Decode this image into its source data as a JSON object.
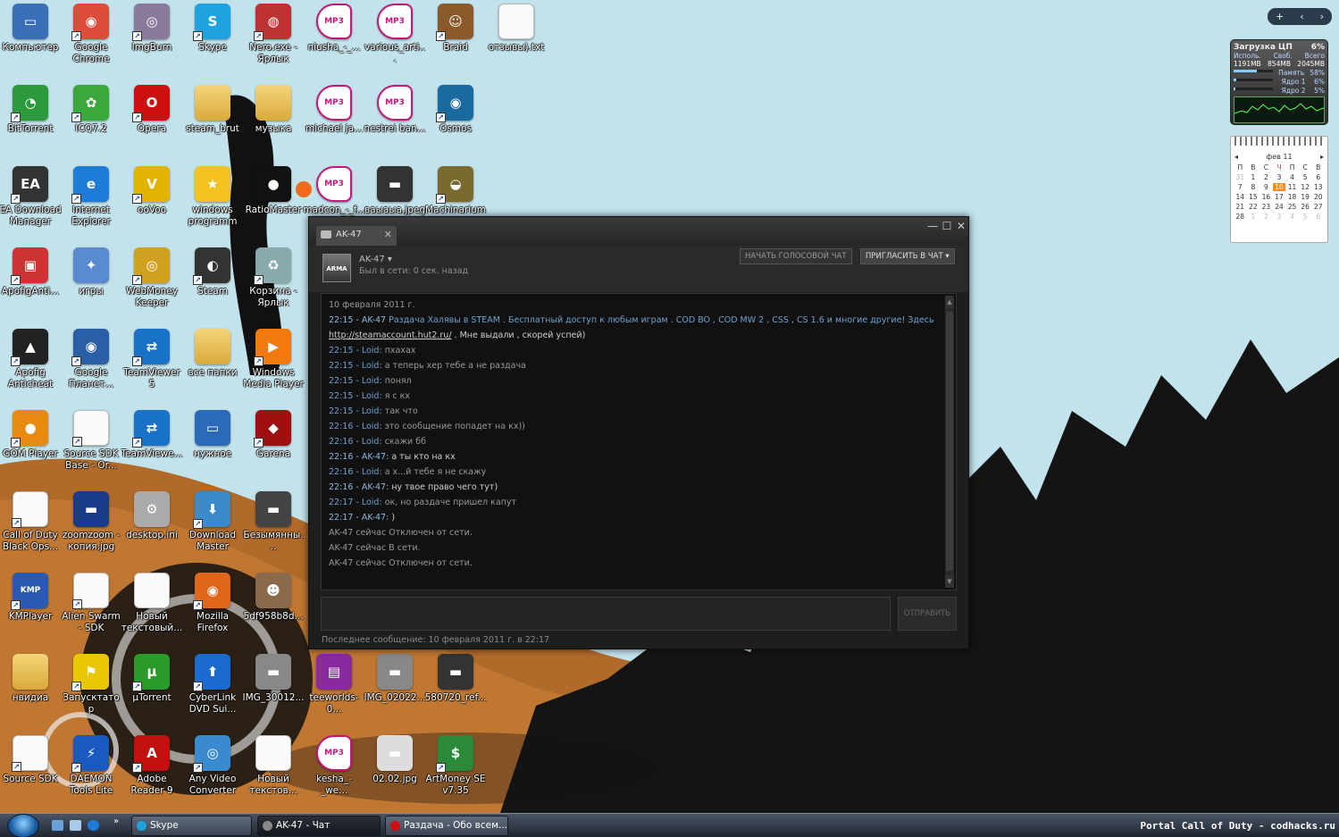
{
  "desktop": {
    "icons": [
      {
        "label": "Компьютер",
        "col": 0,
        "row": 0,
        "color": "#3b6fb5",
        "icon": "computer-icon",
        "glyph": "▭"
      },
      {
        "label": "Google Chrome",
        "col": 1,
        "row": 0,
        "color": "#dd4b39",
        "icon": "chrome-icon",
        "glyph": "◉",
        "shortcut": true
      },
      {
        "label": "ImgBurn",
        "col": 2,
        "row": 0,
        "color": "#8a7a9b",
        "icon": "imgburn-icon",
        "glyph": "◎",
        "shortcut": true
      },
      {
        "label": "Skype",
        "col": 3,
        "row": 0,
        "color": "#1fa2e0",
        "icon": "skype-icon",
        "glyph": "S",
        "shortcut": true
      },
      {
        "label": "Nero.exe - Ярлык",
        "col": 4,
        "row": 0,
        "color": "#b33",
        "icon": "nero-icon",
        "glyph": "◍",
        "shortcut": true
      },
      {
        "label": "niusha_-_...",
        "col": 5,
        "row": 0,
        "icon": "mp3-file-icon",
        "glyph": "MP3",
        "type": "mp3"
      },
      {
        "label": "various_arti...",
        "col": 6,
        "row": 0,
        "icon": "mp3-file-icon",
        "glyph": "MP3",
        "type": "mp3"
      },
      {
        "label": "Braid",
        "col": 7,
        "row": 0,
        "color": "#8b5a2b",
        "icon": "braid-icon",
        "glyph": "☺",
        "shortcut": true
      },
      {
        "label": "отзывы).txt",
        "col": 8,
        "row": 0,
        "icon": "text-file-icon",
        "glyph": "",
        "type": "doc"
      },
      {
        "label": "BitTorrent",
        "col": 0,
        "row": 1,
        "color": "#2a9a3a",
        "icon": "bittorrent-icon",
        "glyph": "◔",
        "shortcut": true
      },
      {
        "label": "ICQ7.2",
        "col": 1,
        "row": 1,
        "color": "#3aa83a",
        "icon": "icq-icon",
        "glyph": "✿",
        "shortcut": true
      },
      {
        "label": "Opera",
        "col": 2,
        "row": 1,
        "color": "#cc1010",
        "icon": "opera-icon",
        "glyph": "O",
        "shortcut": true
      },
      {
        "label": "steam_brut",
        "col": 3,
        "row": 1,
        "icon": "folder-icon",
        "glyph": "",
        "type": "folder"
      },
      {
        "label": "музыка",
        "col": 4,
        "row": 1,
        "icon": "folder-icon",
        "glyph": "",
        "type": "folder"
      },
      {
        "label": "michael ja...",
        "col": 5,
        "row": 1,
        "icon": "mp3-file-icon",
        "glyph": "MP3",
        "type": "mp3"
      },
      {
        "label": "nestrei ban...",
        "col": 6,
        "row": 1,
        "icon": "mp3-file-icon",
        "glyph": "MP3",
        "type": "mp3"
      },
      {
        "label": "Osmos",
        "col": 7,
        "row": 1,
        "color": "#1a6aa0",
        "icon": "osmos-icon",
        "glyph": "◉",
        "shortcut": true
      },
      {
        "label": "EA Download Manager",
        "col": 0,
        "row": 2,
        "color": "#333",
        "icon": "ea-icon",
        "glyph": "EA",
        "shortcut": true
      },
      {
        "label": "Internet Explorer",
        "col": 1,
        "row": 2,
        "color": "#1e7bd6",
        "icon": "internet-explorer-icon",
        "glyph": "e",
        "shortcut": true
      },
      {
        "label": "ooVoo",
        "col": 2,
        "row": 2,
        "color": "#e2b400",
        "icon": "oovoo-icon",
        "glyph": "V",
        "shortcut": true
      },
      {
        "label": "windows programm",
        "col": 3,
        "row": 2,
        "color": "#f3c21c",
        "icon": "star-icon",
        "glyph": "★"
      },
      {
        "label": "RatioMaster",
        "col": 4,
        "row": 2,
        "color": "#111",
        "icon": "ratiomaster-icon",
        "glyph": "●"
      },
      {
        "label": "madcon_-_f...",
        "col": 5,
        "row": 2,
        "icon": "mp3-file-icon",
        "glyph": "MP3",
        "type": "mp3"
      },
      {
        "label": "ваыаыа.jpeg",
        "col": 6,
        "row": 2,
        "color": "#333",
        "icon": "image-file-icon",
        "glyph": "▬"
      },
      {
        "label": "Machinarium",
        "col": 7,
        "row": 2,
        "color": "#7a6a30",
        "icon": "machinarium-icon",
        "glyph": "◒",
        "shortcut": true
      },
      {
        "label": "ApofigAnti...",
        "col": 0,
        "row": 3,
        "color": "#c33",
        "icon": "installer-icon",
        "glyph": "▣",
        "shortcut": true
      },
      {
        "label": "игры",
        "col": 1,
        "row": 3,
        "color": "#5a8ad0",
        "icon": "msn-games-icon",
        "glyph": "✦"
      },
      {
        "label": "WebMoney Keeper Clas...",
        "col": 2,
        "row": 3,
        "color": "#d0a020",
        "icon": "webmoney-icon",
        "glyph": "◎",
        "shortcut": true
      },
      {
        "label": "Steam",
        "col": 3,
        "row": 3,
        "color": "#333",
        "icon": "steam-icon",
        "glyph": "◐",
        "shortcut": true
      },
      {
        "label": "Корзина - Ярлык",
        "col": 4,
        "row": 3,
        "color": "#8aa",
        "icon": "recycle-bin-icon",
        "glyph": "♻",
        "shortcut": true
      },
      {
        "label": "Apofig Anticheat",
        "col": 0,
        "row": 4,
        "color": "#222",
        "icon": "apofig-icon",
        "glyph": "▲",
        "shortcut": true
      },
      {
        "label": "Google Планет...",
        "col": 1,
        "row": 4,
        "color": "#2a5ea6",
        "icon": "google-earth-icon",
        "glyph": "◉",
        "shortcut": true
      },
      {
        "label": "TeamViewer 5",
        "col": 2,
        "row": 4,
        "color": "#1a72c8",
        "icon": "teamviewer-icon",
        "glyph": "⇄",
        "shortcut": true
      },
      {
        "label": "все папки",
        "col": 3,
        "row": 4,
        "icon": "folder-icon",
        "glyph": "",
        "type": "folder"
      },
      {
        "label": "Windows Media Player",
        "col": 4,
        "row": 4,
        "color": "#f07a10",
        "icon": "media-player-icon",
        "glyph": "▶",
        "shortcut": true
      },
      {
        "label": "GOM Player",
        "col": 0,
        "row": 5,
        "color": "#e88a10",
        "icon": "gom-player-icon",
        "glyph": "●",
        "shortcut": true
      },
      {
        "label": "Source SDK Base - Or...",
        "col": 1,
        "row": 5,
        "icon": "text-file-icon",
        "glyph": "",
        "type": "doc",
        "shortcut": true
      },
      {
        "label": "TeamViewe...",
        "col": 2,
        "row": 5,
        "color": "#1a72c8",
        "icon": "teamviewer-icon",
        "glyph": "⇄",
        "shortcut": true
      },
      {
        "label": "нужное",
        "col": 3,
        "row": 5,
        "color": "#2a6ab8",
        "icon": "monitor-icon",
        "glyph": "▭"
      },
      {
        "label": "Garena",
        "col": 4,
        "row": 5,
        "color": "#a01010",
        "icon": "garena-icon",
        "glyph": "◆",
        "shortcut": true
      },
      {
        "label": "Call of Duty Black Ops...",
        "col": 0,
        "row": 6,
        "icon": "text-file-icon",
        "glyph": "",
        "type": "doc",
        "shortcut": true
      },
      {
        "label": "zoomzoom - копия.jpg",
        "col": 1,
        "row": 6,
        "color": "#1a3a8a",
        "icon": "image-file-icon",
        "glyph": "▬"
      },
      {
        "label": "desktop.ini",
        "col": 2,
        "row": 6,
        "color": "#aaa",
        "icon": "settings-file-icon",
        "glyph": "⚙"
      },
      {
        "label": "Download Master",
        "col": 3,
        "row": 6,
        "color": "#3a8acc",
        "icon": "download-master-icon",
        "glyph": "⬇",
        "shortcut": true
      },
      {
        "label": "Безымянны...",
        "col": 4,
        "row": 6,
        "color": "#444",
        "icon": "image-file-icon",
        "glyph": "▬"
      },
      {
        "label": "KMPlayer",
        "col": 0,
        "row": 7,
        "color": "#2a5ab0",
        "icon": "kmplayer-icon",
        "glyph": "KMP",
        "shortcut": true
      },
      {
        "label": "Alien Swarm - SDK",
        "col": 1,
        "row": 7,
        "icon": "text-file-icon",
        "glyph": "",
        "type": "doc",
        "shortcut": true
      },
      {
        "label": "Новый текстовый...",
        "col": 2,
        "row": 7,
        "icon": "text-file-icon",
        "glyph": "",
        "type": "doc"
      },
      {
        "label": "Mozilla Firefox",
        "col": 3,
        "row": 7,
        "color": "#e0661a",
        "icon": "firefox-icon",
        "glyph": "◉",
        "shortcut": true
      },
      {
        "label": "5df958b8d...",
        "col": 4,
        "row": 7,
        "color": "#8a6a4a",
        "icon": "image-file-icon",
        "glyph": "☻"
      },
      {
        "label": "нвидиа",
        "col": 0,
        "row": 8,
        "icon": "folder-icon",
        "glyph": "",
        "type": "folder"
      },
      {
        "label": "Запусктатор",
        "col": 1,
        "row": 8,
        "color": "#e8c800",
        "icon": "launcher-icon",
        "glyph": "⚑",
        "shortcut": true
      },
      {
        "label": "µTorrent",
        "col": 2,
        "row": 8,
        "color": "#2a9a2a",
        "icon": "utorrent-icon",
        "glyph": "µ",
        "shortcut": true
      },
      {
        "label": "CyberLink DVD Sui...",
        "col": 3,
        "row": 8,
        "color": "#1a6ad0",
        "icon": "cyberlink-icon",
        "glyph": "⬆",
        "shortcut": true
      },
      {
        "label": "IMG_30012...",
        "col": 4,
        "row": 8,
        "color": "#888",
        "icon": "image-file-icon",
        "glyph": "▬"
      },
      {
        "label": "teeworlds-0...",
        "col": 5,
        "row": 8,
        "color": "#8a2aa0",
        "icon": "winrar-icon",
        "glyph": "▤"
      },
      {
        "label": "IMG_02022...",
        "col": 6,
        "row": 8,
        "color": "#888",
        "icon": "image-file-icon",
        "glyph": "▬"
      },
      {
        "label": "580720_ref...",
        "col": 7,
        "row": 8,
        "color": "#333",
        "icon": "image-file-icon",
        "glyph": "▬"
      },
      {
        "label": "Source SDK",
        "col": 0,
        "row": 9,
        "icon": "text-file-icon",
        "glyph": "",
        "type": "doc",
        "shortcut": true
      },
      {
        "label": "DAEMON Tools Lite",
        "col": 1,
        "row": 9,
        "color": "#1a5ac0",
        "icon": "daemon-tools-icon",
        "glyph": "⚡",
        "shortcut": true
      },
      {
        "label": "Adobe Reader 9",
        "col": 2,
        "row": 9,
        "color": "#c01010",
        "icon": "adobe-reader-icon",
        "glyph": "A",
        "shortcut": true
      },
      {
        "label": "Any Video Converter",
        "col": 3,
        "row": 9,
        "color": "#3a8ad0",
        "icon": "video-converter-icon",
        "glyph": "◎",
        "shortcut": true
      },
      {
        "label": "Новый текстов...",
        "col": 4,
        "row": 9,
        "icon": "text-file-icon",
        "glyph": "",
        "type": "doc"
      },
      {
        "label": "kesha_-_we...",
        "col": 5,
        "row": 9,
        "icon": "mp3-file-icon",
        "glyph": "MP3",
        "type": "mp3"
      },
      {
        "label": "02.02.jpg",
        "col": 6,
        "row": 9,
        "color": "#ddd",
        "icon": "image-file-icon",
        "glyph": "▬"
      },
      {
        "label": "ArtMoney SE v7.35",
        "col": 7,
        "row": 9,
        "color": "#2a8a3a",
        "icon": "artmoney-icon",
        "glyph": "$",
        "shortcut": true
      }
    ]
  },
  "chat": {
    "tab_title": "AK-47",
    "friend_name": "AK-47",
    "friend_status": "Был в сети: 0 сек. назад",
    "avatar_text": "ARMA",
    "voice_button": "НАЧАТЬ ГОЛОСОВОЙ ЧАТ",
    "invite_button": "ПРИГЛАСИТЬ В ЧАТ",
    "send_button": "ОТПРАВИТЬ",
    "last_message": "Последнее сообщение: 10 февраля 2011 г. в 22:17",
    "messages": [
      {
        "kind": "date",
        "text": "10 февраля 2011 г."
      },
      {
        "kind": "msg",
        "prefix": "22:15 - AK-47 ",
        "body": "Раздача Халявы в STEAM . Бесплатный доступ к любым играм . COD BO , COD MW 2 , CSS , CS 1.6 и многие другие! Здесь",
        "from": "them"
      },
      {
        "kind": "link",
        "link": "http://steamaccount.hut2.ru/",
        "body": " . Мне выдали , скорей успей)"
      },
      {
        "kind": "msg",
        "prefix": "22:15 - Loid: ",
        "body": "пхахах",
        "from": "me"
      },
      {
        "kind": "msg",
        "prefix": "22:15 - Loid: ",
        "body": "а теперь хер тебе а не раздача",
        "from": "me"
      },
      {
        "kind": "msg",
        "prefix": "22:15 - Loid: ",
        "body": "понял",
        "from": "me"
      },
      {
        "kind": "msg",
        "prefix": "22:15 - Loid: ",
        "body": "я с кх",
        "from": "me"
      },
      {
        "kind": "msg",
        "prefix": "22:15 - Loid: ",
        "body": "так что",
        "from": "me"
      },
      {
        "kind": "msg",
        "prefix": "22:16 - Loid: ",
        "body": "это сообщение попадет на кх))",
        "from": "me"
      },
      {
        "kind": "msg",
        "prefix": "22:16 - Loid: ",
        "body": "скажи бб",
        "from": "me"
      },
      {
        "kind": "msg",
        "prefix": "22:16 - AK-47: ",
        "body": "а ты кто на кх",
        "from": "them"
      },
      {
        "kind": "msg",
        "prefix": "22:16 - Loid: ",
        "body": "а х...й тебе я не скажу",
        "from": "me"
      },
      {
        "kind": "msg",
        "prefix": "22:16 - AK-47: ",
        "body": "ну твое право чего тут)",
        "from": "them"
      },
      {
        "kind": "msg",
        "prefix": "22:17 - Loid: ",
        "body": "ок, но раздаче пришел капут",
        "from": "me"
      },
      {
        "kind": "msg",
        "prefix": "22:17 - AK-47: ",
        "body": ")",
        "from": "them"
      },
      {
        "kind": "status",
        "text": "AK-47 сейчас Отключен от сети."
      },
      {
        "kind": "status",
        "text": "AK-47 сейчас В сети."
      },
      {
        "kind": "status",
        "text": "AK-47 сейчас Отключен от сети."
      }
    ]
  },
  "gadgets": {
    "cpu": {
      "title": "Загрузка ЦП",
      "percent": "6%",
      "labels": [
        "Исполь.",
        "Своб.",
        "Всего"
      ],
      "values": [
        "1191MB",
        "854MB",
        "2045MB"
      ],
      "rows": [
        {
          "label": "Память",
          "value": "58%",
          "fill": 0.58
        },
        {
          "label": "Ядро 1",
          "value": "6%",
          "fill": 0.06
        },
        {
          "label": "Ядро 2",
          "value": "5%",
          "fill": 0.05
        }
      ]
    },
    "calendar": {
      "month": "фев 11",
      "weekdays": [
        "П",
        "В",
        "С",
        "Ч",
        "П",
        "С",
        "В"
      ],
      "days": [
        "31",
        "1",
        "2",
        "3",
        "4",
        "5",
        "6",
        "7",
        "8",
        "9",
        "10",
        "11",
        "12",
        "13",
        "14",
        "15",
        "16",
        "17",
        "18",
        "19",
        "20",
        "21",
        "22",
        "23",
        "24",
        "25",
        "26",
        "27",
        "28",
        "1",
        "2",
        "3",
        "4",
        "5",
        "6"
      ],
      "today": "10"
    }
  },
  "taskbar": {
    "buttons": [
      {
        "label": "Skype",
        "color": "#1fa2e0"
      },
      {
        "label": "AK-47 - Чат",
        "color": "#888"
      },
      {
        "label": "Раздача - Обо всем...",
        "color": "#cc1010"
      }
    ],
    "tray_text": "Portal Call of Duty - codhacks.ru"
  }
}
